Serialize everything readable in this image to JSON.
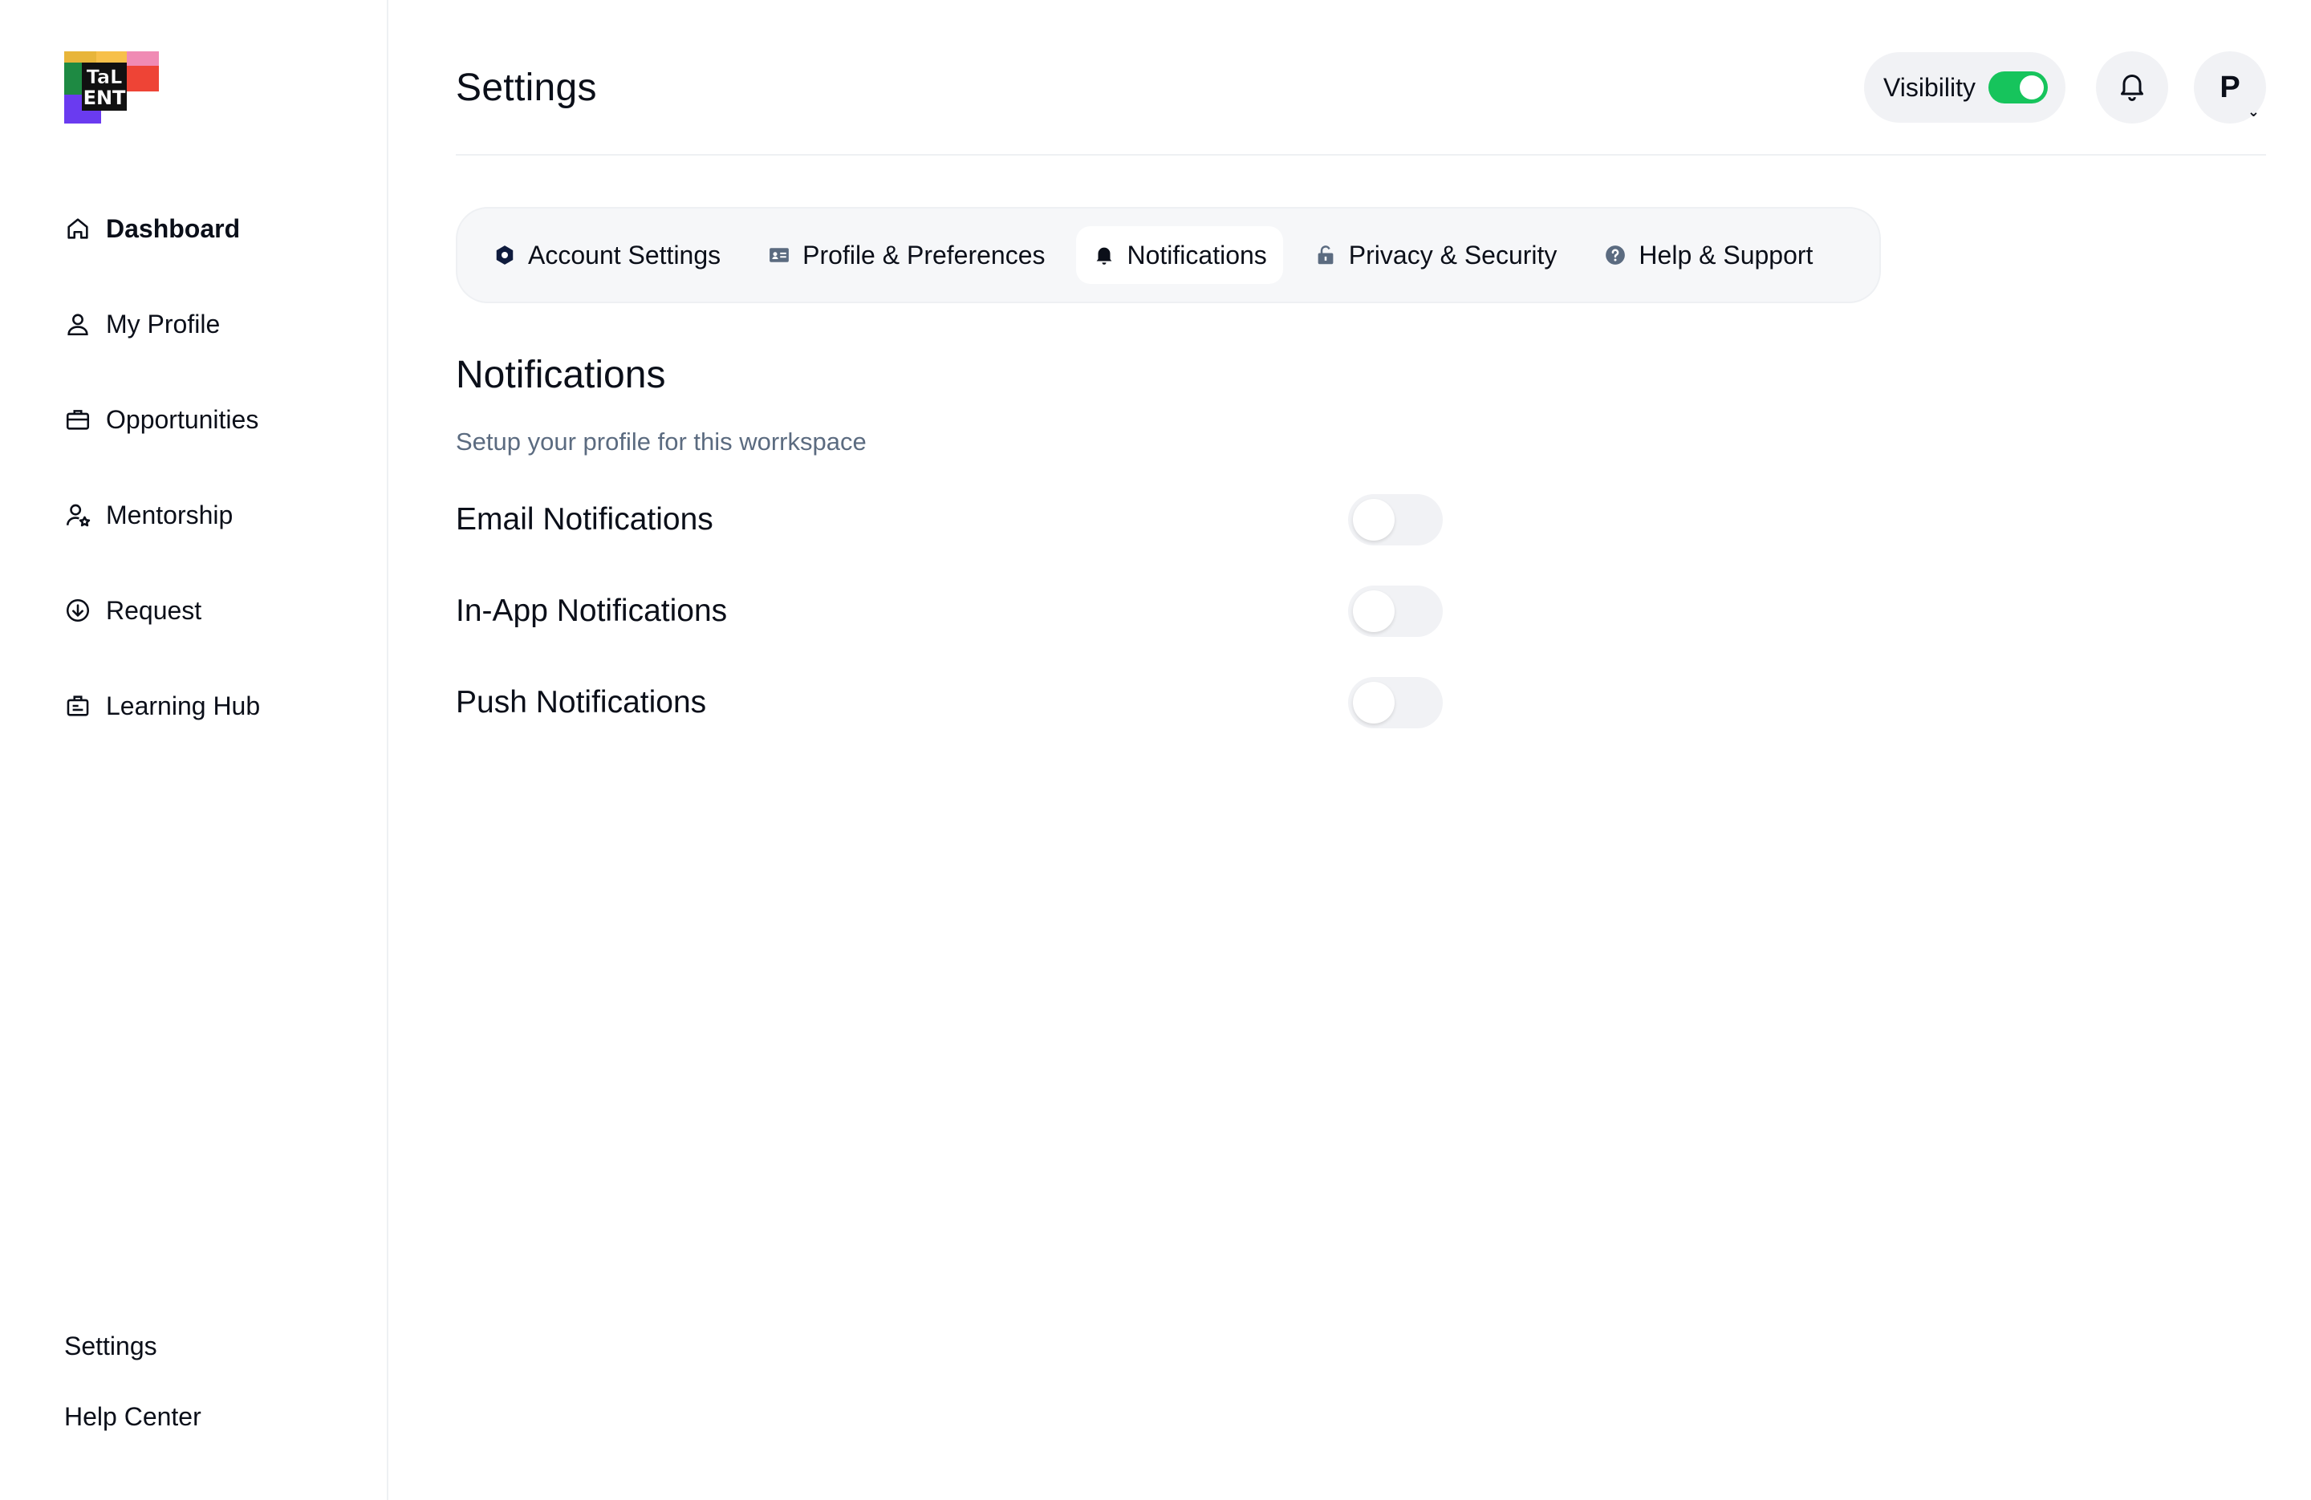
{
  "brand": {
    "logo_text_top": "TaL",
    "logo_text_bottom": "ENT"
  },
  "sidebar": {
    "items": [
      {
        "label": "Dashboard",
        "icon": "home-icon"
      },
      {
        "label": "My Profile",
        "icon": "user-icon"
      },
      {
        "label": "Opportunities",
        "icon": "briefcase-icon"
      },
      {
        "label": "Mentorship",
        "icon": "user-star-icon"
      },
      {
        "label": "Request",
        "icon": "arrow-down-circle-icon"
      },
      {
        "label": "Learning Hub",
        "icon": "learning-icon"
      }
    ],
    "bottom": {
      "settings": "Settings",
      "help_center": "Help Center"
    }
  },
  "header": {
    "title": "Settings",
    "visibility_label": "Visibility",
    "visibility_on": true,
    "avatar_initial": "P"
  },
  "tabs": [
    {
      "label": "Account Settings",
      "icon": "hexagon-icon"
    },
    {
      "label": "Profile & Preferences",
      "icon": "id-card-icon"
    },
    {
      "label": "Notifications",
      "icon": "bell-icon",
      "active": true
    },
    {
      "label": "Privacy & Security",
      "icon": "lock-icon"
    },
    {
      "label": "Help & Support",
      "icon": "question-circle-icon"
    }
  ],
  "notifications": {
    "title": "Notifications",
    "subtitle": "Setup your profile for this worrkspace",
    "settings": [
      {
        "label": "Email Notifications",
        "enabled": false
      },
      {
        "label": "In-App Notifications",
        "enabled": false
      },
      {
        "label": "Push Notifications",
        "enabled": false
      }
    ]
  },
  "colors": {
    "toggle_on": "#16c45c",
    "toggle_off": "#f1f2f5",
    "subtitle": "#5b6b80"
  }
}
